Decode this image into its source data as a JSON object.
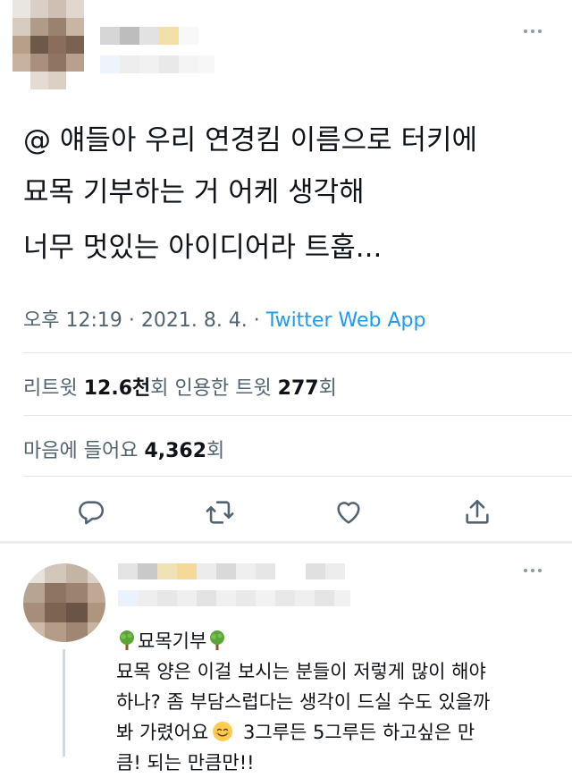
{
  "tweet": {
    "text_line1": "@ 얘들아 우리 연경킴 이름으로 터키에",
    "text_line2": "묘목 기부하는 거 어케 생각해",
    "text_line3": "너무 멋있는 아이디어라 트훕...",
    "meta_time": "오후 12:19 · 2021. 8. 4. · ",
    "meta_source": "Twitter Web App",
    "retweets_label": "리트윗 ",
    "retweets_value": "12.6천",
    "retweets_suffix": "회  ",
    "quotes_label": "인용한 트윗 ",
    "quotes_value": "277",
    "quotes_suffix": "회",
    "likes_label": "마음에 들어요 ",
    "likes_value": "4,362",
    "likes_suffix": "회"
  },
  "actions": [
    {
      "name": "reply-icon"
    },
    {
      "name": "retweet-icon"
    },
    {
      "name": "like-icon"
    },
    {
      "name": "share-icon"
    }
  ],
  "reply": {
    "heading": "묘목기부",
    "line1": "묘목 양은 이걸 보시는 분들이 저렇게 많이 해야",
    "line2": "하나? 좀 부담스럽다는 생각이 드실 수도 있을까",
    "line3_a": "봐 가렸어요",
    "line3_b": " 3그루든 5그루든 하고싶은 만",
    "line4": "큼! 되는 만큼만!!"
  },
  "colors": {
    "text": "#0f1419",
    "secondary": "#536471",
    "link": "#1d9bf0",
    "divider": "#e1e6ea",
    "icon": "#536471"
  }
}
